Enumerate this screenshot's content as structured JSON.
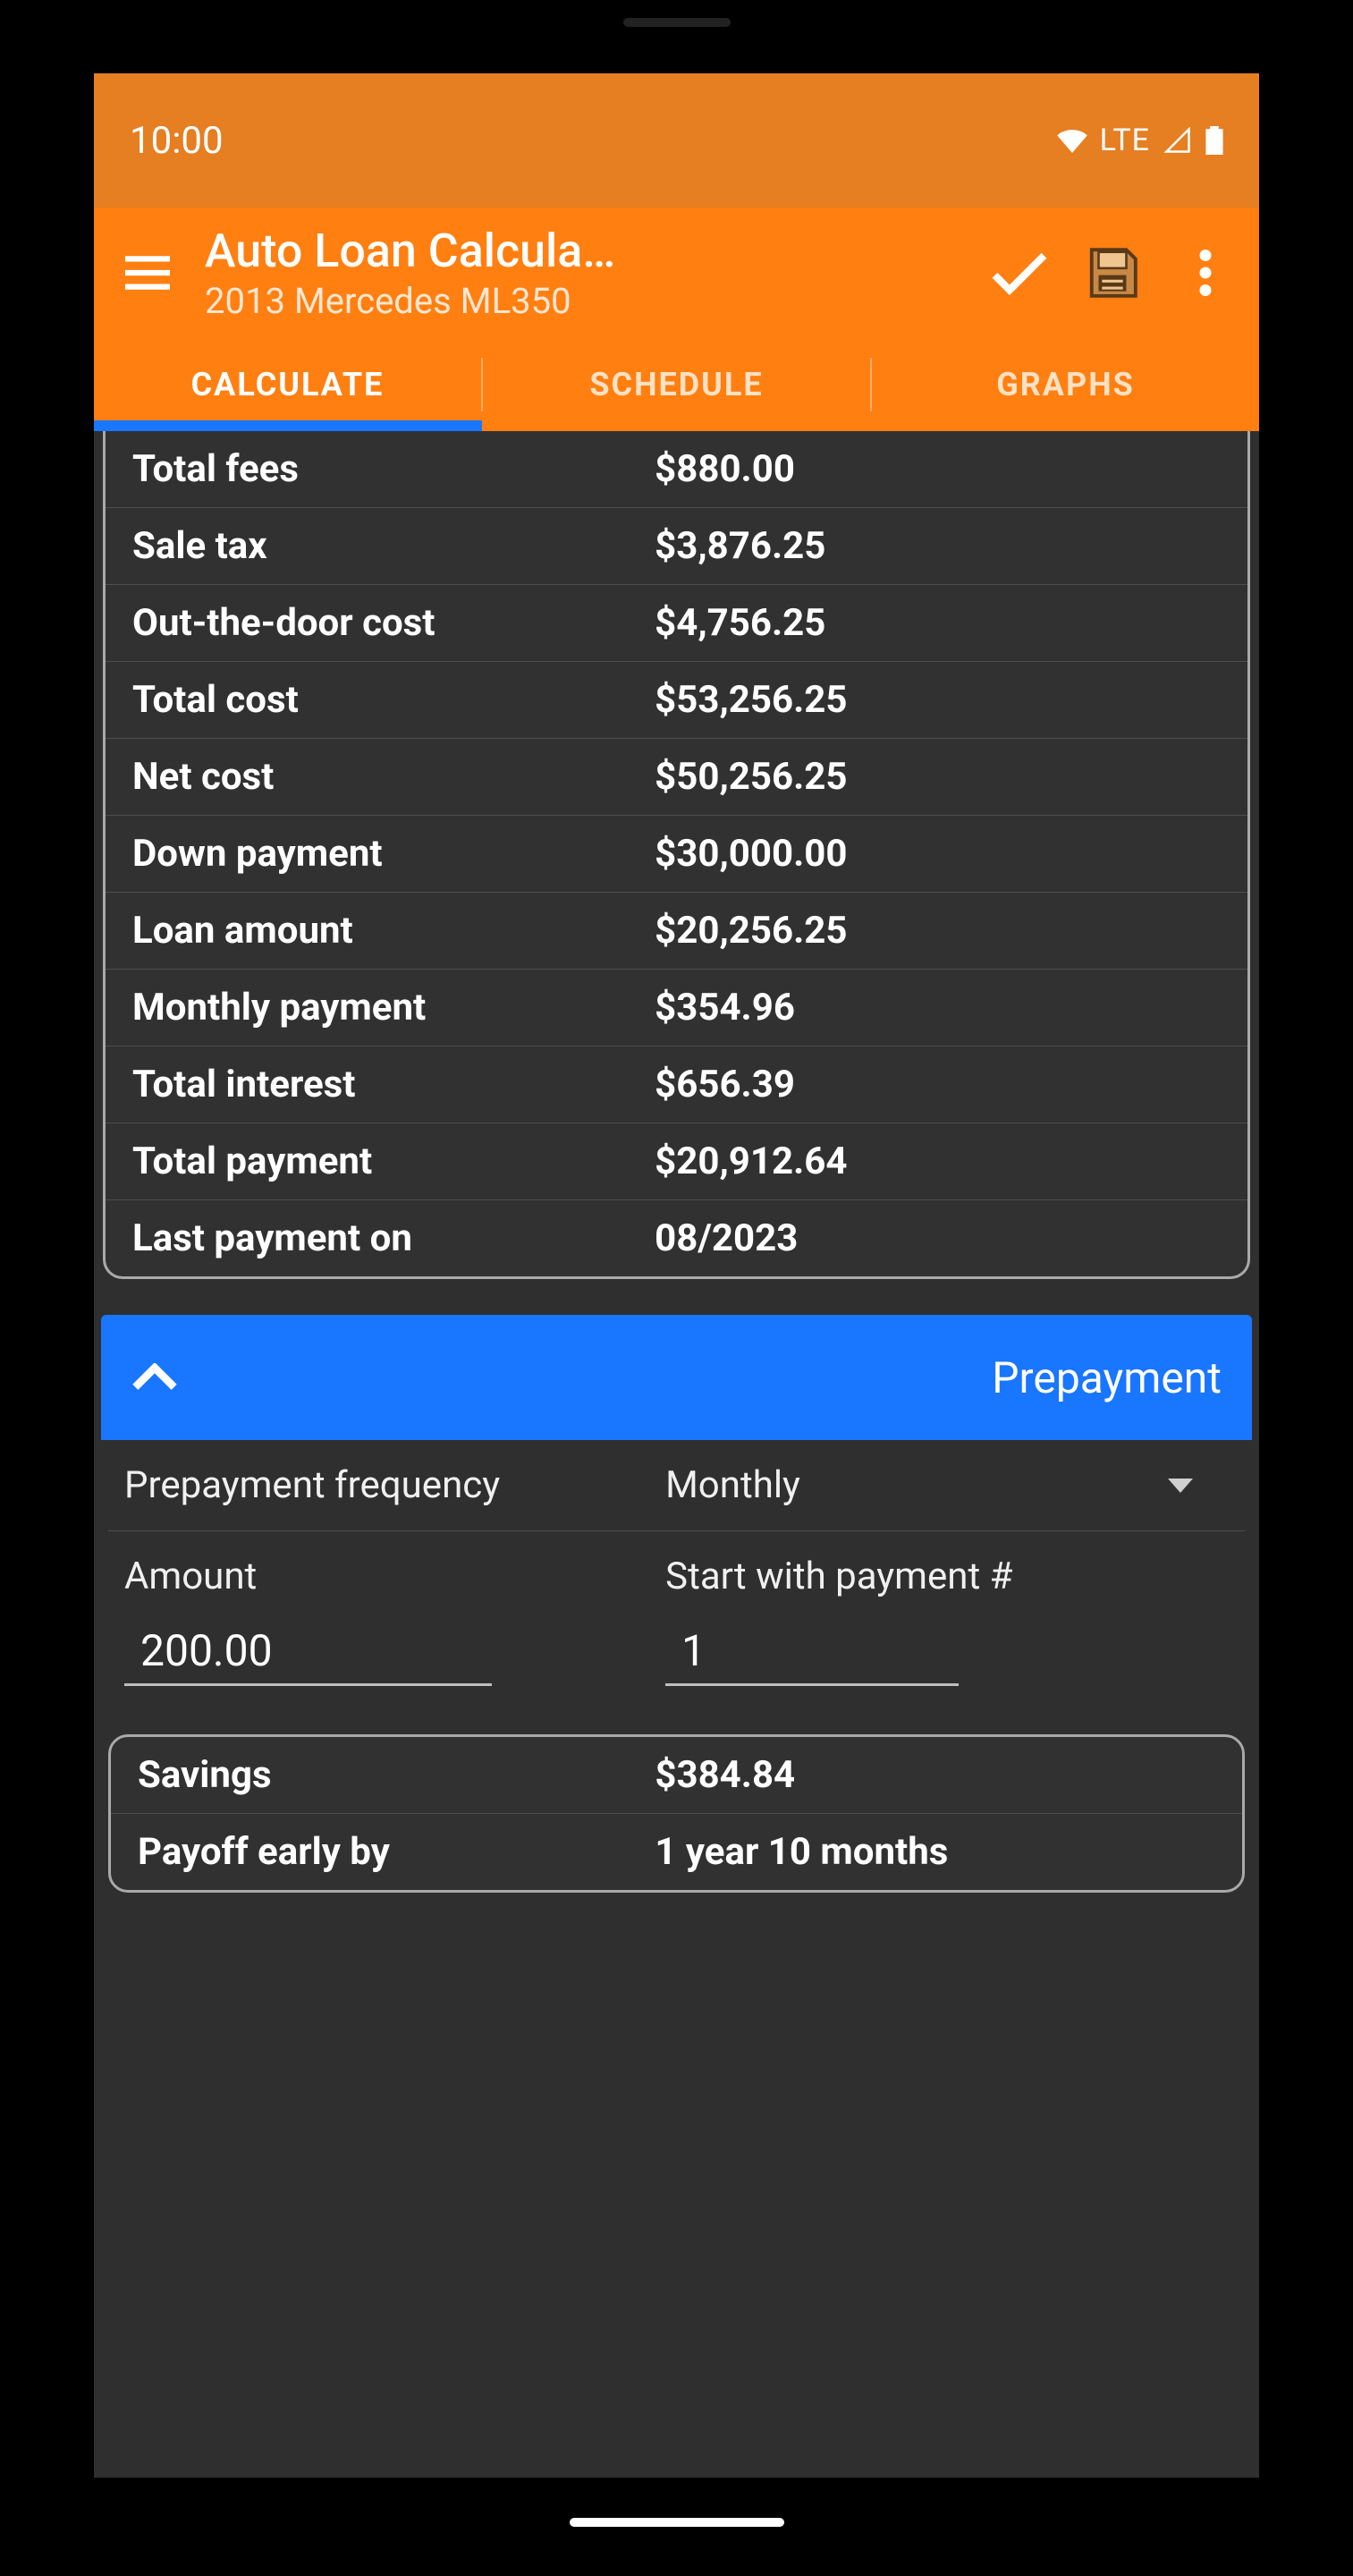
{
  "statusbar": {
    "time": "10:00",
    "network": "LTE"
  },
  "appbar": {
    "title": "Auto Loan Calcula…",
    "subtitle": "2013 Mercedes ML350"
  },
  "tabs": {
    "items": [
      "CALCULATE",
      "SCHEDULE",
      "GRAPHS"
    ],
    "active_index": 0
  },
  "results": [
    {
      "label": "Total fees",
      "value": "$880.00"
    },
    {
      "label": "Sale tax",
      "value": "$3,876.25"
    },
    {
      "label": "Out-the-door cost",
      "value": "$4,756.25"
    },
    {
      "label": "Total cost",
      "value": "$53,256.25"
    },
    {
      "label": "Net cost",
      "value": "$50,256.25"
    },
    {
      "label": "Down payment",
      "value": "$30,000.00"
    },
    {
      "label": "Loan amount",
      "value": "$20,256.25"
    },
    {
      "label": "Monthly payment",
      "value": "$354.96"
    },
    {
      "label": "Total interest",
      "value": "$656.39"
    },
    {
      "label": "Total payment",
      "value": "$20,912.64"
    },
    {
      "label": "Last payment on",
      "value": "08/2023"
    }
  ],
  "prepayment": {
    "section_title": "Prepayment",
    "frequency_label": "Prepayment frequency",
    "frequency_value": "Monthly",
    "amount_label": "Amount",
    "amount_value": "200.00",
    "start_label": "Start with payment #",
    "start_value": "1",
    "results": [
      {
        "label": "Savings",
        "value": "$384.84"
      },
      {
        "label": "Payoff early by",
        "value": "1 year 10 months"
      }
    ]
  },
  "colors": {
    "status_bg": "#e67e22",
    "appbar_bg": "#ff7f11",
    "accent_blue": "#1976ff",
    "content_bg": "#2f2f2f"
  }
}
